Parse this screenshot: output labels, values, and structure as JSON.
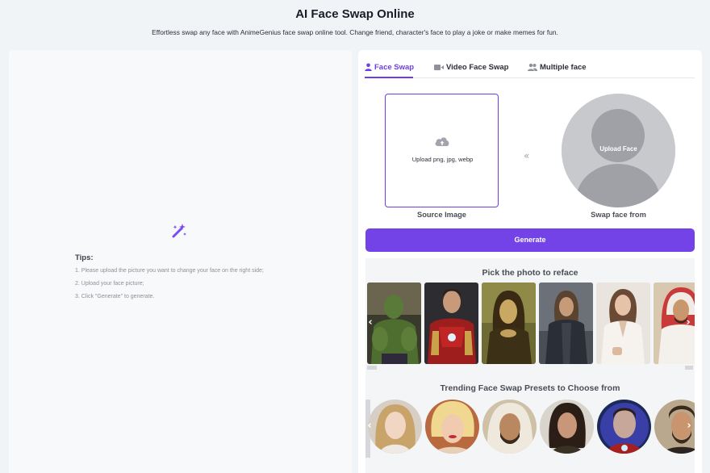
{
  "header": {
    "title": "AI Face Swap Online",
    "subtitle": "Effortless swap any face with AnimeGenius face swap online tool. Change friend, character's face to play a joke or make memes for fun."
  },
  "tips": {
    "title": "Tips:",
    "items": [
      "1. Please upload the picture you want to change your face on the right side;",
      "2. Upload your face picture;",
      "3. Click \"Generate\" to generate."
    ]
  },
  "tabs": [
    {
      "label": "Face Swap",
      "icon": "user-icon",
      "active": true
    },
    {
      "label": "Video Face Swap",
      "icon": "video-icon",
      "active": false
    },
    {
      "label": "Multiple face",
      "icon": "users-icon",
      "active": false
    }
  ],
  "upload": {
    "source_text": "Upload png, jpg, webp",
    "source_label": "Source Image",
    "swap_arrow": "«",
    "face_text": "Upload Face",
    "face_label": "Swap face from"
  },
  "generate_label": "Generate",
  "presets": {
    "pick_title": "Pick the photo to reface",
    "trending_title": "Trending Face Swap Presets to Choose from",
    "photos": [
      "hulk",
      "iron-man",
      "mona-lisa",
      "hooded-man",
      "woman-white-suit",
      "arab-man"
    ],
    "faces": [
      "blonde-woman",
      "marilyn",
      "arab-man",
      "long-hair-man",
      "iron-man-helmet",
      "bearded-man"
    ],
    "prev_arrow": "‹",
    "next_arrow": "›"
  },
  "colors": {
    "accent": "#6d3ee6",
    "button": "#7343e8",
    "background": "#f1f4f7"
  }
}
